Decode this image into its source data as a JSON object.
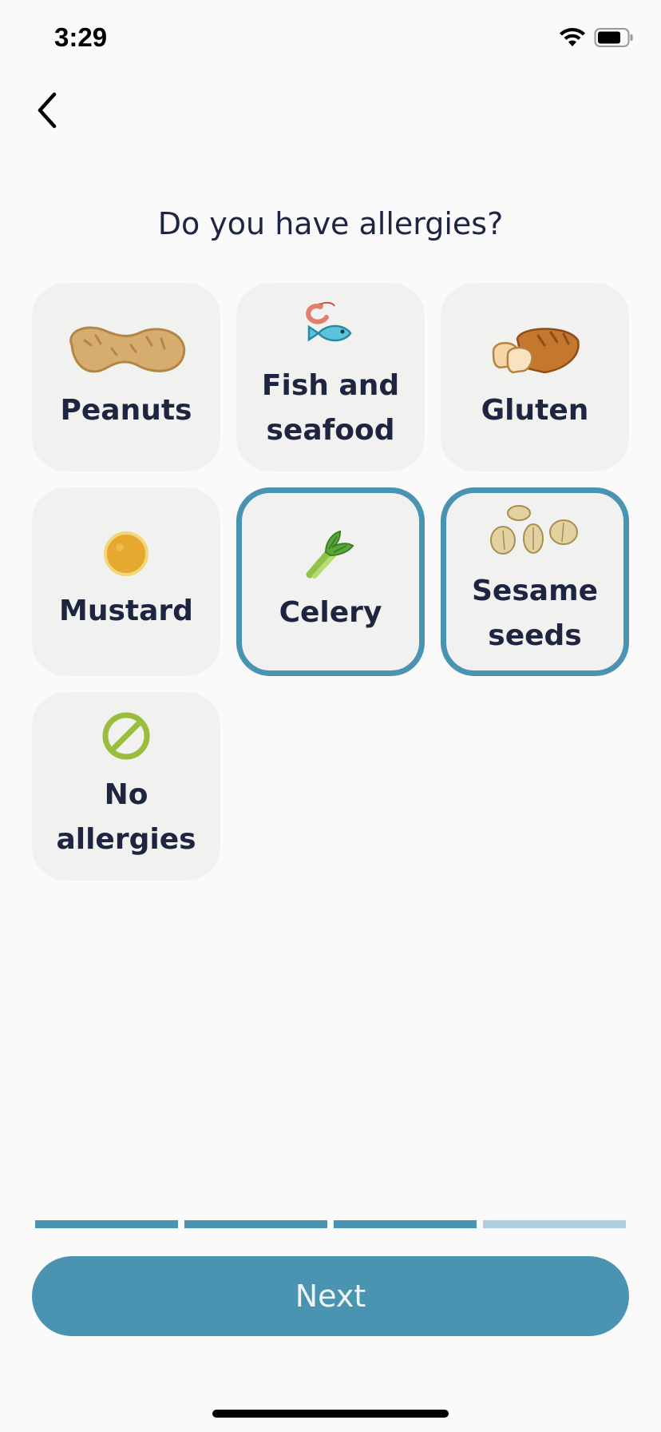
{
  "status_bar": {
    "time": "3:29",
    "icons": [
      "wifi-icon",
      "battery-icon"
    ]
  },
  "nav": {
    "back_icon": "chevron-left-icon"
  },
  "question": "Do you have allergies?",
  "options": [
    {
      "label": "Peanuts",
      "icon": "peanut-icon",
      "selected": false
    },
    {
      "label": "Fish and seafood",
      "icon": "fish-seafood-icon",
      "selected": false
    },
    {
      "label": "Gluten",
      "icon": "bread-icon",
      "selected": false
    },
    {
      "label": "Mustard",
      "icon": "mustard-icon",
      "selected": false
    },
    {
      "label": "Celery",
      "icon": "celery-icon",
      "selected": true
    },
    {
      "label": "Sesame seeds",
      "icon": "sesame-seeds-icon",
      "selected": true
    },
    {
      "label": "No allergies",
      "icon": "no-allergies-icon",
      "selected": false
    }
  ],
  "progress": {
    "steps_total": 4,
    "steps_completed": 3,
    "active_color": "#4a93b1",
    "inactive_color": "#aecfdd"
  },
  "next_button": {
    "label": "Next"
  },
  "colors": {
    "accent": "#4a93b1",
    "card_bg": "#f1f1ef",
    "text": "#1e2540",
    "background": "#fafafa"
  }
}
